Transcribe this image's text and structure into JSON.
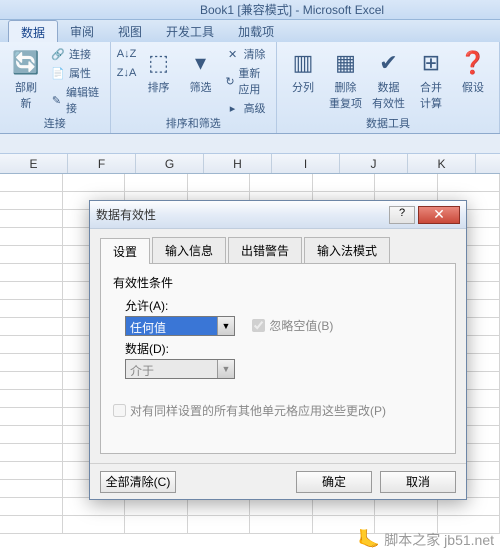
{
  "title": "Book1 [兼容模式] - Microsoft Excel",
  "tabs": {
    "data": "数据",
    "review": "审阅",
    "view": "视图",
    "dev": "开发工具",
    "addins": "加载项"
  },
  "ribbon": {
    "refresh": "部刷新",
    "conn": "连接",
    "prop": "属性",
    "editlink": "编辑链接",
    "group1": "连接",
    "sort": "排序",
    "az": "A↓Z",
    "za": "Z↓A",
    "filter": "筛选",
    "clear": "清除",
    "reapply": "重新应用",
    "adv": "高级",
    "group2": "排序和筛选",
    "texttocol": "分列",
    "dedup": "删除\n重复项",
    "validation": "数据\n有效性",
    "consolidate": "合并计算",
    "whatif": "假设",
    "group3": "数据工具"
  },
  "cols": [
    "E",
    "F",
    "G",
    "H",
    "I",
    "J",
    "K"
  ],
  "dialog": {
    "title": "数据有效性",
    "tabs": {
      "settings": "设置",
      "input": "输入信息",
      "error": "出错警告",
      "ime": "输入法模式"
    },
    "section": "有效性条件",
    "allow_label": "允许(A):",
    "allow_value": "任何值",
    "ignore_blank": "忽略空值(B)",
    "data_label": "数据(D):",
    "data_value": "介于",
    "applyall": "对有同样设置的所有其他单元格应用这些更改(P)",
    "clearall": "全部清除(C)",
    "ok": "确定",
    "cancel": "取消"
  },
  "watermark": "脚本之家 jb51.net"
}
